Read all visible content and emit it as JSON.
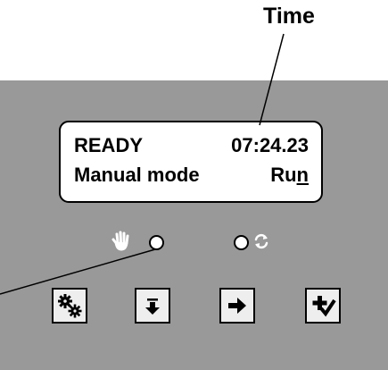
{
  "callout": {
    "time_label": "Time"
  },
  "display": {
    "status": "READY",
    "time": "07:24.23",
    "mode": "Manual mode",
    "action_prefix": "Ru",
    "action_underlined": "n"
  },
  "indicators": {
    "manual": {
      "icon": "hand-icon",
      "state": "off"
    },
    "auto": {
      "icon": "cycle-icon",
      "state": "off"
    }
  },
  "buttons": [
    {
      "icon": "gears-icon"
    },
    {
      "icon": "step-down-icon"
    },
    {
      "icon": "arrow-right-icon"
    },
    {
      "icon": "plus-check-icon"
    }
  ],
  "colors": {
    "panel": "#999999",
    "display_background": "#ffffff",
    "button_face": "#eeeeee"
  }
}
